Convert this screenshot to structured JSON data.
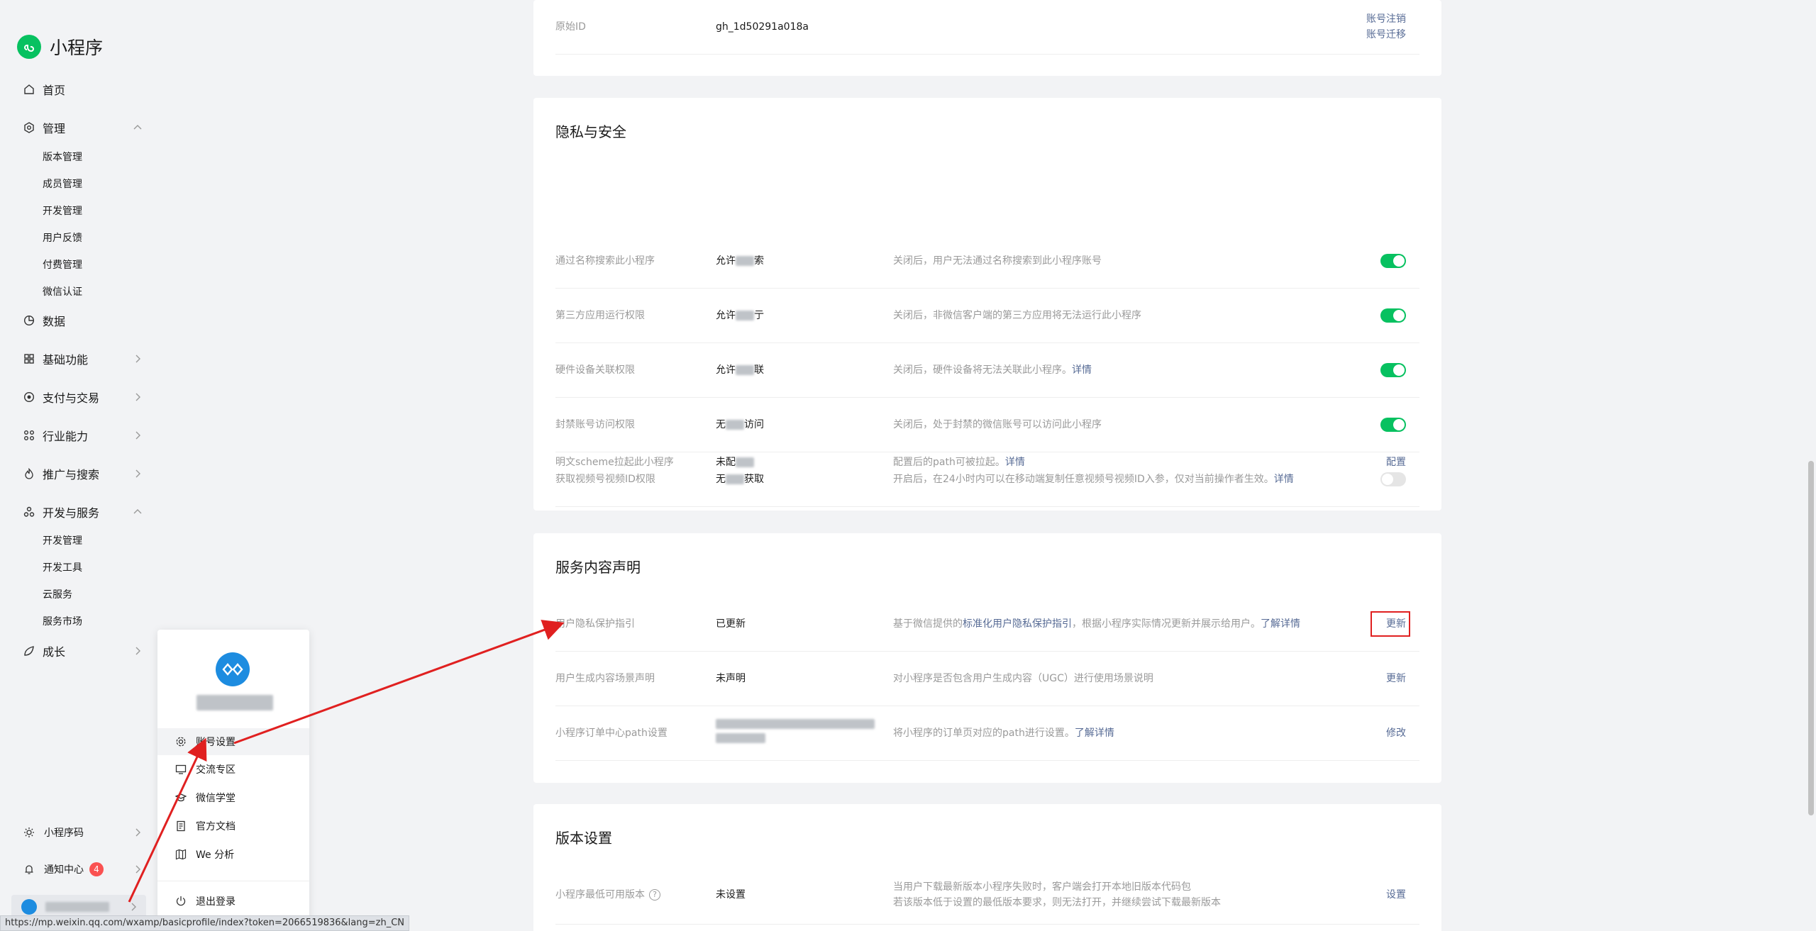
{
  "brand": {
    "name": "小程序"
  },
  "sidebar": {
    "items": [
      {
        "label": "首页"
      },
      {
        "label": "管理"
      },
      {
        "label": "数据"
      },
      {
        "label": "基础功能"
      },
      {
        "label": "支付与交易"
      },
      {
        "label": "行业能力"
      },
      {
        "label": "推广与搜索"
      },
      {
        "label": "开发与服务"
      },
      {
        "label": "成长"
      }
    ],
    "manage_sub": [
      "版本管理",
      "成员管理",
      "开发管理",
      "用户反馈",
      "付费管理",
      "微信认证"
    ],
    "dev_sub": [
      "开发管理",
      "开发工具",
      "云服务",
      "服务市场"
    ],
    "bottom": [
      {
        "label": "小程序码"
      },
      {
        "label": "通知中心",
        "badge": "4"
      }
    ]
  },
  "popup": {
    "items": [
      "账号设置",
      "交流专区",
      "微信学堂",
      "官方文档",
      "We 分析",
      "退出登录"
    ]
  },
  "basic": {
    "row": {
      "label": "原始ID",
      "value": "gh_1d50291a018a",
      "action1": "账号注销",
      "action2": "账号迁移"
    }
  },
  "privacy": {
    "title": "隐私与安全",
    "rows": [
      {
        "label": "通过名称搜索此小程序",
        "value": "允许",
        "value2": "索",
        "desc": "关闭后，用户无法通过名称搜索到此小程序账号"
      },
      {
        "label": "第三方应用运行权限",
        "value": "允许",
        "value2": "亍",
        "desc": "关闭后，非微信客户端的第三方应用将无法运行此小程序"
      },
      {
        "label": "硬件设备关联权限",
        "value": "允许",
        "value2": "联",
        "desc": "关闭后，硬件设备将无法关联此小程序。",
        "link": "详情"
      },
      {
        "label": "封禁账号访问权限",
        "value": "无",
        "value2": "访问",
        "desc": "关闭后，处于封禁的微信账号可以访问此小程序"
      },
      {
        "label": "获取视频号视频ID权限",
        "value": "无",
        "value2": "获取",
        "desc": "开启后，在24小时内可以在移动端复制任意视频号视频ID入参，仅对当前操作者生效。",
        "link": "详情"
      },
      {
        "label": "明文scheme拉起此小程序",
        "value": "未配",
        "desc": "配置后的path可被拉起。",
        "link": "详情",
        "action": "配置"
      }
    ]
  },
  "service": {
    "title": "服务内容声明",
    "rows": [
      {
        "label": "用户隐私保护指引",
        "value": "已更新",
        "desc_pre": "基于微信提供的",
        "desc_link": "标准化用户隐私保护指引",
        "desc_post": "，根据小程序实际情况更新并展示给用户。",
        "link": "了解详情",
        "action": "更新"
      },
      {
        "label": "用户生成内容场景声明",
        "value": "未声明",
        "desc": "对小程序是否包含用户生成内容（UGC）进行使用场景说明",
        "action": "更新"
      },
      {
        "label": "小程序订单中心path设置",
        "desc": "将小程序的订单页对应的path进行设置。",
        "link": "了解详情",
        "action": "修改"
      }
    ]
  },
  "version": {
    "title": "版本设置",
    "row": {
      "label": "小程序最低可用版本",
      "help": "?",
      "value": "未设置",
      "desc1": "当用户下载最新版本小程序失败时，客户端会打开本地旧版本代码包",
      "desc2": "若该版本低于设置的最低版本要求，则无法打开，并继续尝试下载最新版本",
      "action": "设置"
    }
  },
  "statusbar": {
    "url": "https://mp.weixin.qq.com/wxamp/basicprofile/index?token=2066519836&lang=zh_CN"
  },
  "colors": {
    "accent": "#07c160",
    "link": "#576b95",
    "highlight": "#e02020"
  }
}
